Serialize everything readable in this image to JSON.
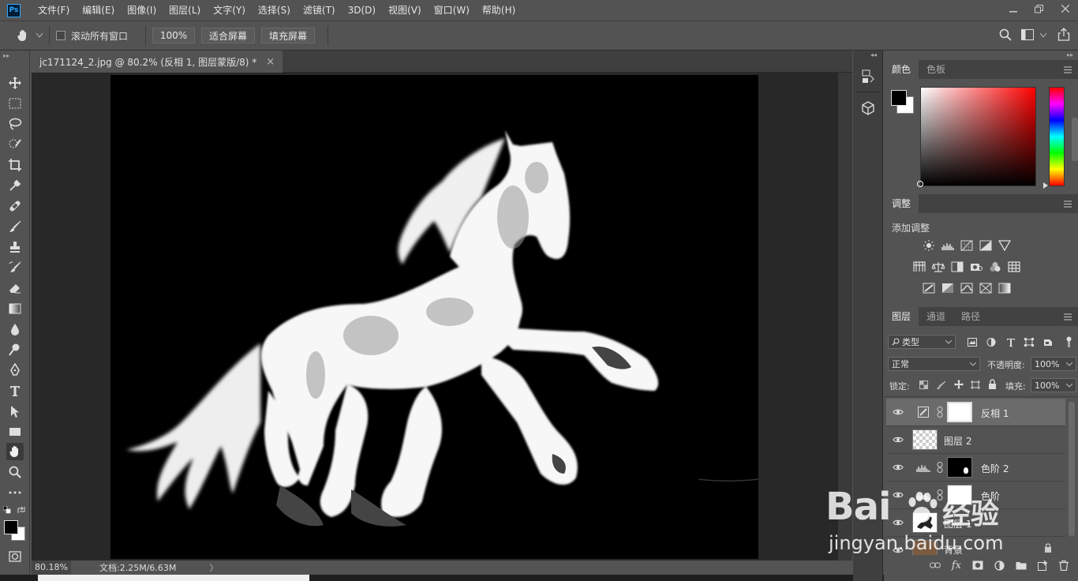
{
  "menubar": {
    "logo": "Ps",
    "items": [
      "文件(F)",
      "编辑(E)",
      "图像(I)",
      "图层(L)",
      "文字(Y)",
      "选择(S)",
      "滤镜(T)",
      "3D(D)",
      "视图(V)",
      "窗口(W)",
      "帮助(H)"
    ]
  },
  "options": {
    "scroll_all_label": "滚动所有窗口",
    "zoom_value": "100%",
    "fit_screen": "适合屏幕",
    "fill_screen": "填充屏幕"
  },
  "document": {
    "tab_title": "jc171124_2.jpg @ 80.2% (反相 1, 图层蒙版/8) *",
    "close_glyph": "×"
  },
  "status": {
    "zoom": "80.18%",
    "doc_info": "文档:2.25M/6.63M",
    "arrow": "〉"
  },
  "color_panel": {
    "tabs": [
      "颜色",
      "色板"
    ],
    "accent_red": "#ff0000"
  },
  "adjustments_panel": {
    "tab": "调整",
    "add_label": "添加调整"
  },
  "layers_panel": {
    "tabs": [
      "图层",
      "通道",
      "路径"
    ],
    "filter_kind": "类型",
    "blend_mode": "正常",
    "opacity_label": "不透明度:",
    "opacity_value": "100%",
    "lock_label": "锁定:",
    "fill_label": "填充:",
    "fill_value": "100%",
    "layers": [
      {
        "name": "反相 1"
      },
      {
        "name": "图层 2"
      },
      {
        "name": "色阶 2"
      },
      {
        "name": "色阶"
      },
      {
        "name": "图层 1"
      },
      {
        "name": "背景"
      }
    ],
    "footer_fx": "fx"
  },
  "watermark": {
    "brand": "Bai",
    "brand2": "经验",
    "url": "jingyan.baidu.com"
  }
}
